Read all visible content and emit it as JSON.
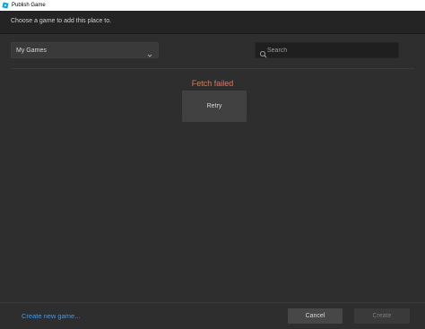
{
  "window": {
    "title": "Publish Game",
    "app_icon": "roblox-studio-icon"
  },
  "header": {
    "instruction": "Choose a game to add this place to."
  },
  "filter": {
    "selected": "My Games",
    "icon": "chevron-down-icon"
  },
  "search": {
    "placeholder": "Search",
    "value": "",
    "icon": "search-icon"
  },
  "status": {
    "error_message": "Fetch failed",
    "error_color": "#ff6a4c"
  },
  "actions": {
    "retry_label": "Retry",
    "create_new_label": "Create new game...",
    "cancel_label": "Cancel",
    "create_label": "Create",
    "link_color": "#3d9be9"
  }
}
